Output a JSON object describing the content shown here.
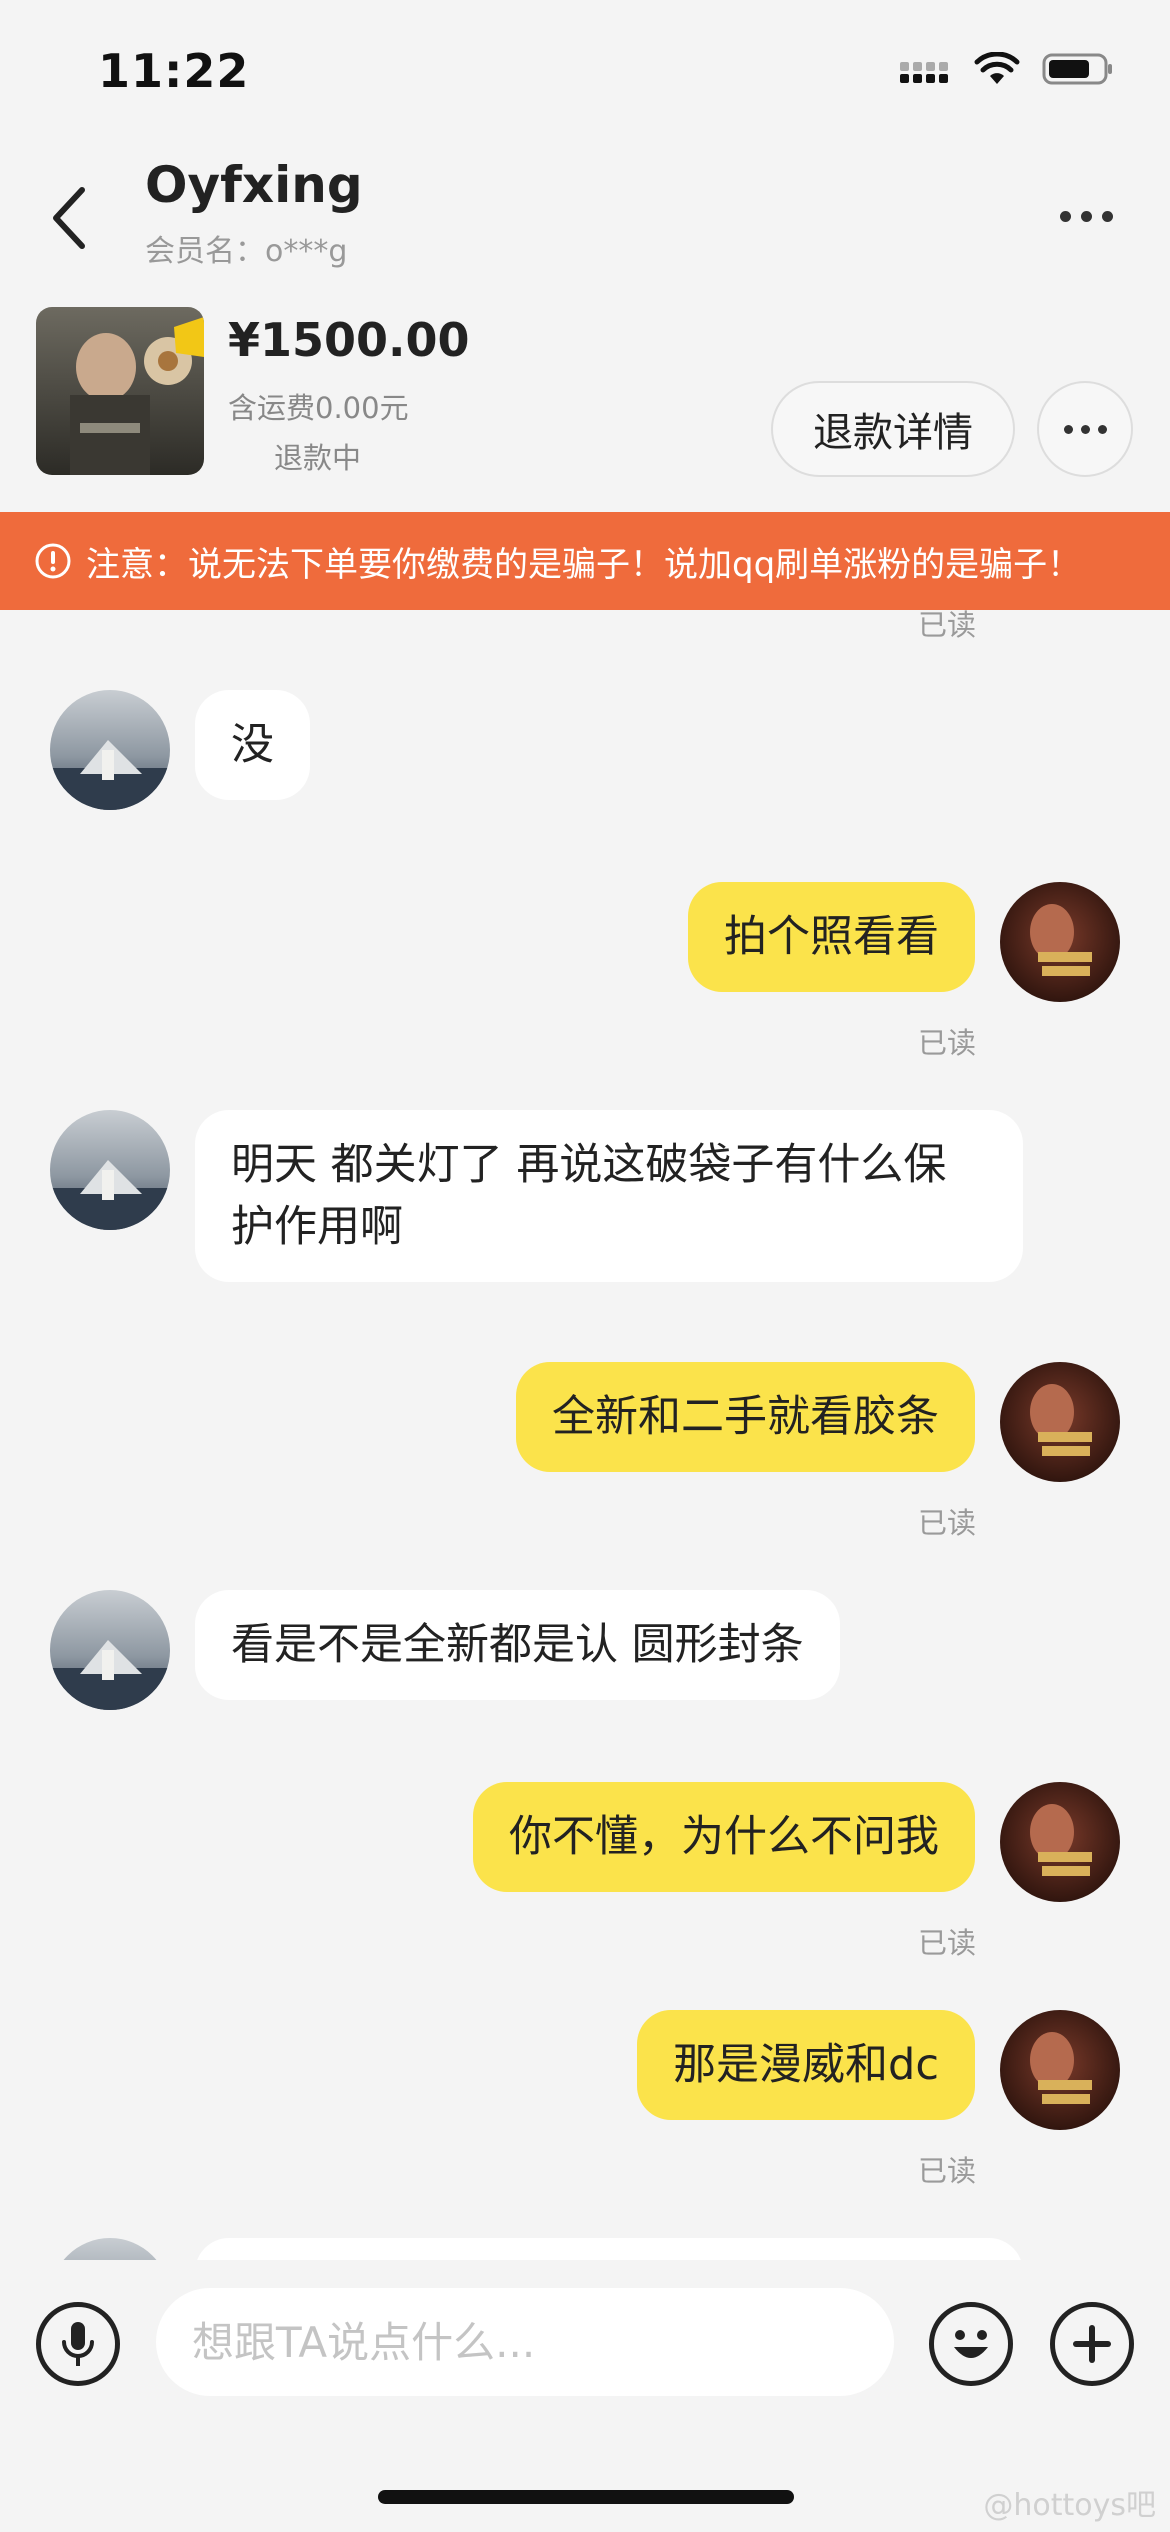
{
  "status_bar": {
    "time": "11:22"
  },
  "header": {
    "name": "Oyfxing",
    "member_label": "会员名：",
    "member_value": "o***g"
  },
  "product": {
    "price": "¥1500.00",
    "shipping": "含运费0.00元",
    "status": "退款中",
    "refund_button": "退款详情"
  },
  "warning": {
    "text": "注意：说无法下单要你缴费的是骗子！说加qq刷单涨粉的是骗子！"
  },
  "messages": [
    {
      "side": "left",
      "text": "没"
    },
    {
      "side": "right",
      "text": "拍个照看看",
      "read": "已读"
    },
    {
      "side": "left",
      "text": "明天  都关灯了  再说这破袋子有什么保护作用啊"
    },
    {
      "side": "right",
      "text": "全新和二手就看胶条",
      "read": "已读"
    },
    {
      "side": "left",
      "text": "看是不是全新都是认 圆形封条"
    },
    {
      "side": "right",
      "text": "你不懂，为什么不问我",
      "read": "已读"
    },
    {
      "side": "right",
      "text": "那是漫威和dc",
      "read": "已读"
    }
  ],
  "top_read_mark": "已读",
  "input": {
    "placeholder": "想跟TA说点什么..."
  },
  "watermark": "@hottoys吧",
  "colors": {
    "warning": "#ef6b3c",
    "self_bubble": "#fbe34b",
    "other_bubble": "#ffffff",
    "background": "#f4f4f4"
  }
}
